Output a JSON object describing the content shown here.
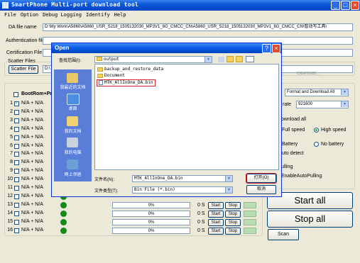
{
  "window": {
    "title": "SmartPhone Multi-port download tool",
    "minimize": "_",
    "maximize": "□",
    "close": "×"
  },
  "menu": [
    "File",
    "Option",
    "Debug Logging",
    "Identify",
    "Help"
  ],
  "files": {
    "da_label": "DA file name",
    "da_value": "D:\\My Work\\A5860\\A5860_USR_S218_1505132030_MP3V1_8G_CMCC_CN\\A5860_USR_S218_1505132030_MP3V1_8G_CMCC_CN\\智动写工具\\",
    "auth_label": "Authentication file",
    "cert_label": "Certification File",
    "scatter_group": "Scatter Files",
    "scatter_button": "Scatter File",
    "scatter_value": "D:\\",
    "scatter_tail": "CN\\MT6582..."
  },
  "ports": {
    "header": "BootRom+Pre",
    "rows": [
      {
        "num": "1",
        "checked": true,
        "label": "N/A + N/A"
      },
      {
        "num": "2",
        "checked": false,
        "label": "N/A + N/A"
      },
      {
        "num": "3",
        "checked": false,
        "label": "N/A + N/A"
      },
      {
        "num": "4",
        "checked": false,
        "label": "N/A + N/A"
      },
      {
        "num": "5",
        "checked": false,
        "label": "N/A + N/A"
      },
      {
        "num": "6",
        "checked": false,
        "label": "N/A + N/A"
      },
      {
        "num": "7",
        "checked": false,
        "label": "N/A + N/A"
      },
      {
        "num": "8",
        "checked": false,
        "label": "N/A + N/A"
      },
      {
        "num": "9",
        "checked": false,
        "label": "N/A + N/A"
      },
      {
        "num": "10",
        "checked": false,
        "label": "N/A + N/A"
      },
      {
        "num": "11",
        "checked": false,
        "label": "N/A + N/A"
      },
      {
        "num": "12",
        "checked": false,
        "label": "N/A + N/A"
      },
      {
        "num": "13",
        "checked": false,
        "label": "N/A + N/A",
        "progress": "0%",
        "time": "0 S",
        "start": "Start",
        "stop": "Stop"
      },
      {
        "num": "14",
        "checked": false,
        "label": "N/A + N/A",
        "progress": "0%",
        "time": "0 S",
        "start": "Start",
        "stop": "Stop"
      },
      {
        "num": "15",
        "checked": false,
        "label": "N/A + N/A",
        "progress": "0%",
        "time": "0 S",
        "start": "Start",
        "stop": "Stop"
      },
      {
        "num": "16",
        "checked": false,
        "label": "N/A + N/A",
        "progress": "0%",
        "time": "0 S",
        "start": "Start",
        "stop": "Stop"
      }
    ]
  },
  "right": {
    "mode": "Format and Download All",
    "baud_label": "rate",
    "baud": "921600",
    "download_group": "ownload all",
    "full_speed": "Full speed",
    "high_speed": "High speed",
    "battery": "Battery",
    "no_battery": "No battery",
    "auto_detect": "uto detect",
    "pulling_group": "ulling",
    "auto_pulling": "EnableAutoPulling",
    "start_all": "Start all",
    "stop_all": "Stop all",
    "scan": "Scan"
  },
  "dialog": {
    "title": "Open",
    "lookin_label": "查找范围(I):",
    "lookin_value": "output",
    "places": [
      "我最近的文档",
      "桌面",
      "我的文档",
      "我的电脑",
      "网上邻居"
    ],
    "items": [
      {
        "name": "backup_and_restore_data",
        "type": "folder"
      },
      {
        "name": "Document",
        "type": "folder"
      },
      {
        "name": "MTK_AllInOne_DA.bin",
        "type": "file",
        "selected": true
      }
    ],
    "filename_label": "文件名(N):",
    "filename_value": "MTK_AllInOne_DA.bin",
    "filetype_label": "文件类型(T):",
    "filetype_value": "Bin File (*.bin)",
    "open_button": "打开(O)",
    "cancel_button": "取消",
    "help": "?",
    "close": "×"
  },
  "colors": {
    "highlight": "#d2232a",
    "titlebar": "#0a56d8",
    "status_ok": "#118a16"
  }
}
